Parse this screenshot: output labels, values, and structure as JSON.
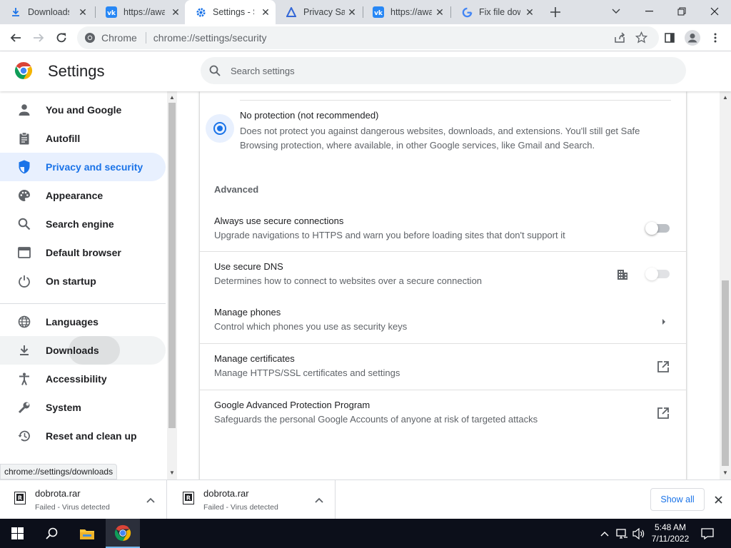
{
  "browser": {
    "tabs": [
      {
        "title": "Downloads",
        "icon": "download-icon",
        "active": false
      },
      {
        "title": "https://awa",
        "icon": "vk-icon",
        "active": false
      },
      {
        "title": "Settings - S",
        "icon": "gear-icon",
        "active": true
      },
      {
        "title": "Privacy San",
        "icon": "triangle-icon",
        "active": false
      },
      {
        "title": "https://awa",
        "icon": "vk-icon",
        "active": false
      },
      {
        "title": "Fix file dow",
        "icon": "google-icon",
        "active": false
      }
    ],
    "omnibox": {
      "site_label": "Chrome",
      "url": "chrome://settings/security"
    }
  },
  "settings": {
    "title": "Settings",
    "search_placeholder": "Search settings",
    "nav": [
      {
        "label": "You and Google",
        "icon": "person-icon"
      },
      {
        "label": "Autofill",
        "icon": "clipboard-icon"
      },
      {
        "label": "Privacy and security",
        "icon": "shield-icon",
        "selected": true
      },
      {
        "label": "Appearance",
        "icon": "palette-icon"
      },
      {
        "label": "Search engine",
        "icon": "search-icon"
      },
      {
        "label": "Default browser",
        "icon": "browser-icon"
      },
      {
        "label": "On startup",
        "icon": "power-icon"
      },
      {
        "label": "Languages",
        "icon": "globe-icon"
      },
      {
        "label": "Downloads",
        "icon": "download-icon",
        "hovered": true
      },
      {
        "label": "Accessibility",
        "icon": "accessibility-icon"
      },
      {
        "label": "System",
        "icon": "wrench-icon"
      },
      {
        "label": "Reset and clean up",
        "icon": "history-icon"
      }
    ],
    "status_url": "chrome://settings/downloads",
    "no_protection": {
      "title": "No protection (not recommended)",
      "description": "Does not protect you against dangerous websites, downloads, and extensions. You'll still get Safe Browsing protection, where available, in other Google services, like Gmail and Search."
    },
    "advanced_heading": "Advanced",
    "rows": [
      {
        "title": "Always use secure connections",
        "subtitle": "Upgrade navigations to HTTPS and warn you before loading sites that don't support it",
        "control": "toggle",
        "on": false
      },
      {
        "title": "Use secure DNS",
        "subtitle": "Determines how to connect to websites over a secure connection",
        "control": "toggle-disabled-managed",
        "on": false
      },
      {
        "title": "Manage phones",
        "subtitle": "Control which phones you use as security keys",
        "control": "arrow"
      },
      {
        "title": "Manage certificates",
        "subtitle": "Manage HTTPS/SSL certificates and settings",
        "control": "external"
      },
      {
        "title": "Google Advanced Protection Program",
        "subtitle": "Safeguards the personal Google Accounts of anyone at risk of targeted attacks",
        "control": "external"
      }
    ]
  },
  "downloads": {
    "items": [
      {
        "name": "dobrota.rar",
        "status": "Failed - Virus detected"
      },
      {
        "name": "dobrota.rar",
        "status": "Failed - Virus detected"
      }
    ],
    "show_all": "Show all"
  },
  "taskbar": {
    "time": "5:48 AM",
    "date": "7/11/2022"
  },
  "colors": {
    "accent": "#1a73e8",
    "selected_bg": "#e8f0fe",
    "taskbar": "#0c0f1a"
  }
}
